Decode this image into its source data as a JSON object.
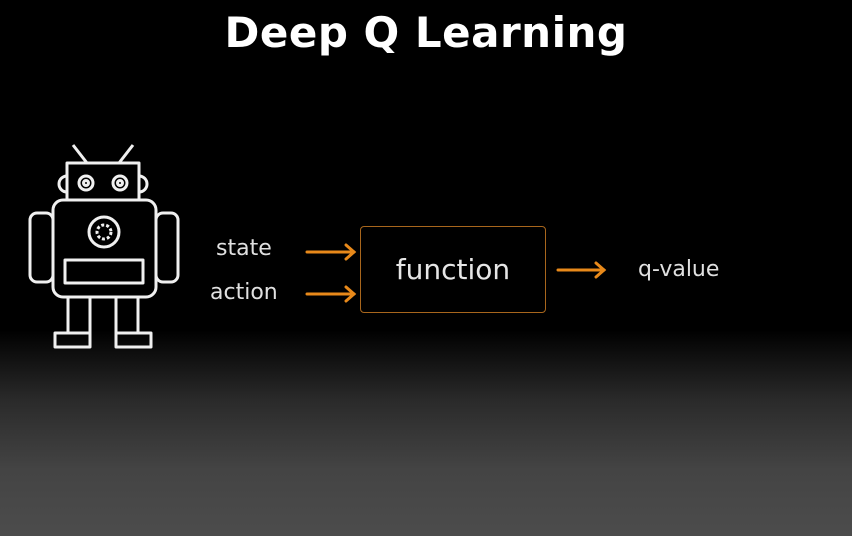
{
  "title": "Deep Q Learning",
  "inputs": {
    "state": "state",
    "action": "action"
  },
  "function_label": "function",
  "output_label": "q-value",
  "colors": {
    "arrow": "#e8891a",
    "box_border": "#a8661c",
    "robot": "#f0f0f0"
  },
  "icons": {
    "agent": "robot-icon"
  }
}
